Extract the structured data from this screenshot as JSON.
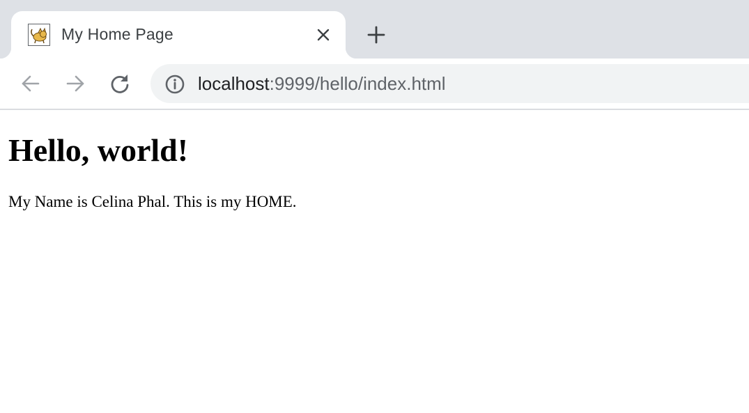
{
  "browser": {
    "tab": {
      "title": "My Home Page",
      "favicon": "tomcat-favicon-icon"
    },
    "new_tab": "plus-icon",
    "nav": {
      "back": "arrow-left-icon",
      "forward": "arrow-right-icon",
      "reload": "reload-icon"
    },
    "address": {
      "host": "localhost",
      "rest": ":9999/hello/index.html",
      "site_info_icon": "info-icon"
    }
  },
  "page": {
    "heading": "Hello, world!",
    "paragraph": "My Name is Celina Phal. This is my HOME."
  },
  "colors": {
    "tabstrip": "#dee1e6",
    "omnibox": "#f1f3f4",
    "icon_active": "#5f6368",
    "icon_disabled": "#a0a4a8"
  }
}
